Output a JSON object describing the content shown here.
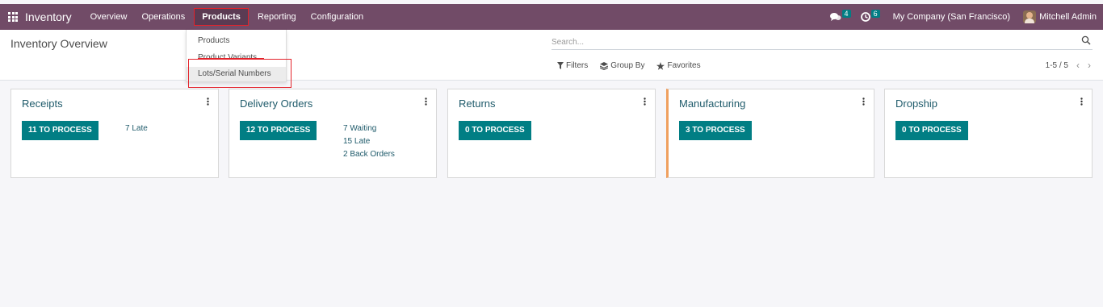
{
  "navbar": {
    "brand": "Inventory",
    "menu": [
      "Overview",
      "Operations",
      "Products",
      "Reporting",
      "Configuration"
    ],
    "active_menu": "Products",
    "messages_count": "4",
    "activities_count": "6",
    "company": "My Company (San Francisco)",
    "user": "Mitchell Admin"
  },
  "dropdown": {
    "items": [
      "Products",
      "Product Variants",
      "Lots/Serial Numbers"
    ],
    "highlighted": "Lots/Serial Numbers"
  },
  "control_panel": {
    "title": "Inventory Overview",
    "search_placeholder": "Search...",
    "filters_label": "Filters",
    "group_by_label": "Group By",
    "favorites_label": "Favorites",
    "pager": "1-5 / 5"
  },
  "cards": [
    {
      "title": "Receipts",
      "button": "11 TO PROCESS",
      "stats": [
        "7 Late"
      ]
    },
    {
      "title": "Delivery Orders",
      "button": "12 TO PROCESS",
      "stats": [
        "7 Waiting",
        "15 Late",
        "2 Back Orders"
      ]
    },
    {
      "title": "Returns",
      "button": "0 TO PROCESS",
      "stats": []
    },
    {
      "title": "Manufacturing",
      "button": "3 TO PROCESS",
      "stats": [],
      "accent": "#f0a05f"
    },
    {
      "title": "Dropship",
      "button": "0 TO PROCESS",
      "stats": []
    }
  ],
  "colors": {
    "navbar": "#714b67",
    "primary_button": "#017e84",
    "highlight_outline": "#e3232b",
    "card_title": "#1e5a6a"
  }
}
